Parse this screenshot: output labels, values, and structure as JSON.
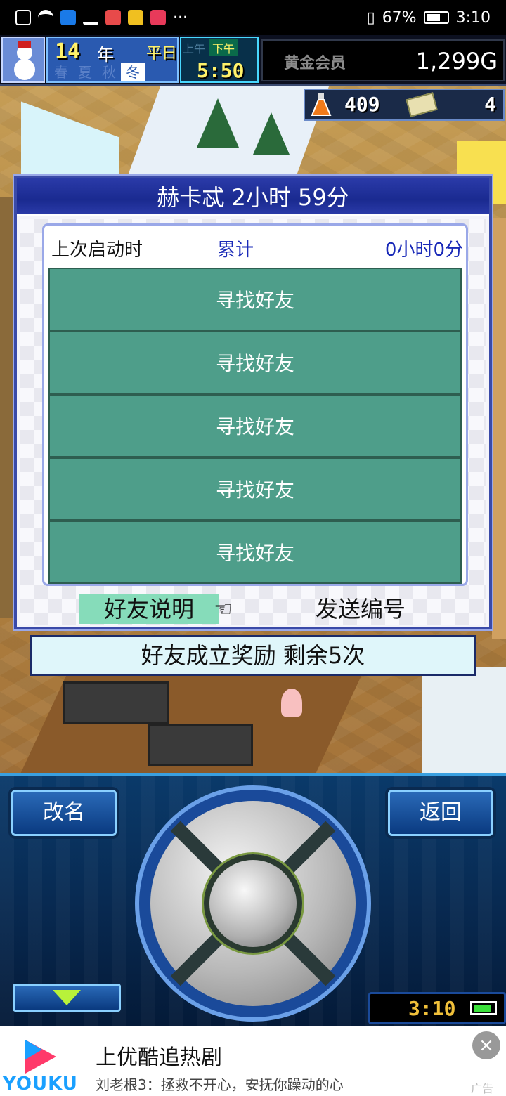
{
  "status_bar": {
    "battery": "67%",
    "time": "3:10"
  },
  "hud": {
    "year": "14",
    "year_unit": "年",
    "day_type": "平日",
    "seasons": [
      "春",
      "夏",
      "秋",
      "冬"
    ],
    "active_season_index": 3,
    "am_label": "上午",
    "pm_label": "下午",
    "clock": "5:50",
    "member_label": "黄金会员",
    "money": "1,299G",
    "flask_count": "409",
    "ticket_count": "4"
  },
  "dialog": {
    "title": "赫卡忒  2小时 59分",
    "last_launch_label": "上次启动时",
    "total_label": "累计",
    "total_value": "0小时0分",
    "friend_slots": [
      "寻找好友",
      "寻找好友",
      "寻找好友",
      "寻找好友",
      "寻找好友"
    ],
    "explain_button": "好友说明",
    "send_button": "发送编号"
  },
  "reward": {
    "text": "好友成立奖励  剩余5次"
  },
  "controller": {
    "rename_button": "改名",
    "back_button": "返回",
    "clock": "3:10"
  },
  "ad": {
    "brand": "YOUKU",
    "title": "上优酷追热剧",
    "subtitle": "刘老根3：拯救不开心，安抚你躁动的心",
    "tag": "广告",
    "close": "×"
  },
  "colors": {
    "dialog_title_bg": "#2a3aa8",
    "friend_row_bg": "#4e9e8a",
    "accent_blue": "#1a2ab8",
    "explain_btn_bg": "#86dcba",
    "controller_bg": "#082a52"
  }
}
